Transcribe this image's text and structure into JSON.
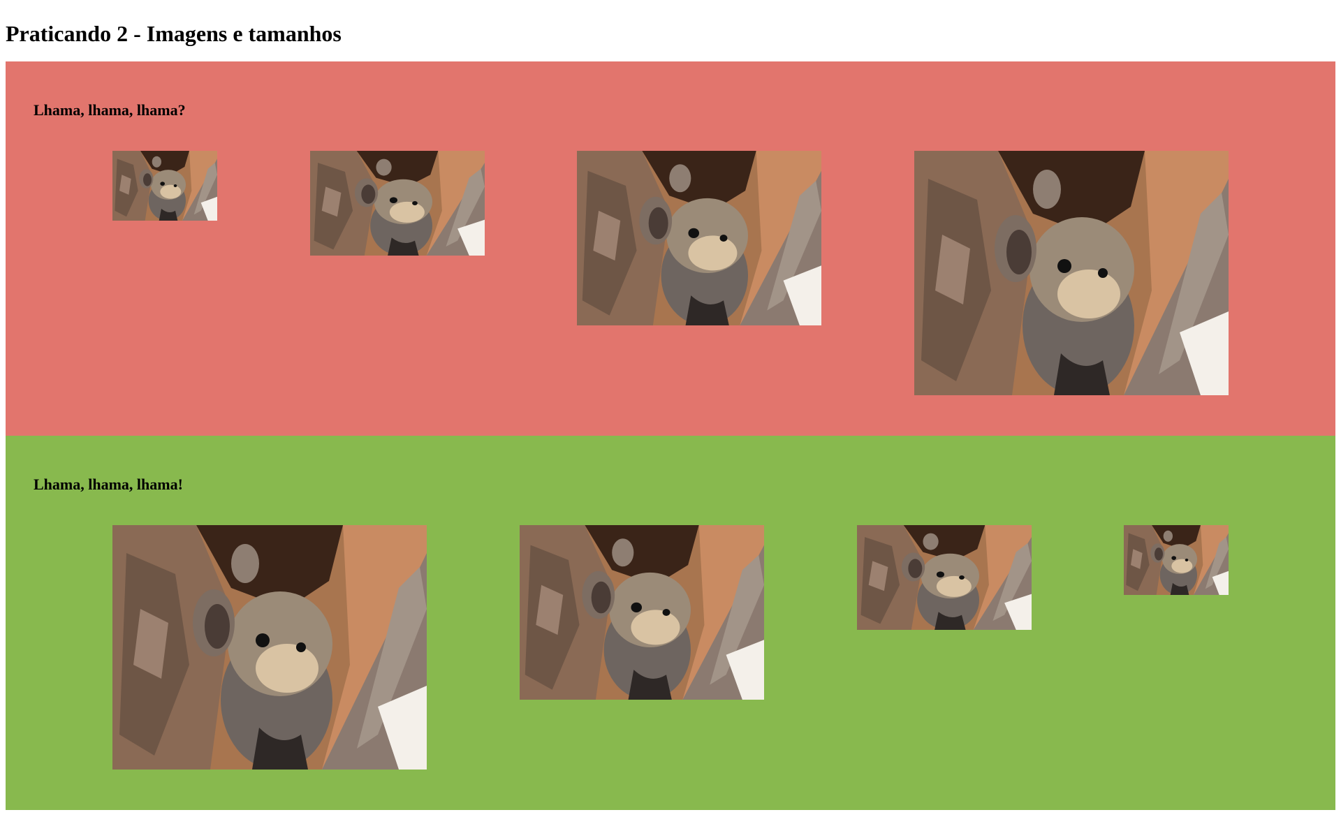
{
  "page": {
    "title": "Praticando 2 - Imagens e tamanhos"
  },
  "sections": [
    {
      "heading": "Lhama, lhama, lhama?",
      "background": "#e2756d",
      "images": [
        {
          "icon": "pika-photo",
          "size_class": "tiny"
        },
        {
          "icon": "pika-photo",
          "size_class": "small"
        },
        {
          "icon": "pika-photo",
          "size_class": "medium"
        },
        {
          "icon": "pika-photo",
          "size_class": "large"
        }
      ]
    },
    {
      "heading": "Lhama, lhama, lhama!",
      "background": "#88b94e",
      "images": [
        {
          "icon": "pika-photo",
          "size_class": "large"
        },
        {
          "icon": "pika-photo",
          "size_class": "medium"
        },
        {
          "icon": "pika-photo",
          "size_class": "small"
        },
        {
          "icon": "pika-photo",
          "size_class": "tiny"
        }
      ]
    }
  ]
}
